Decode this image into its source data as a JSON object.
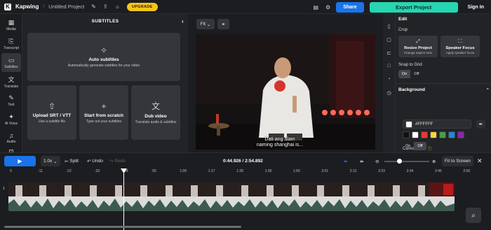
{
  "topbar": {
    "brand": "Kapwing",
    "project_title": "Untitled Project",
    "upgrade_label": "UPGRADE",
    "share_label": "Share",
    "export_label": "Export Project",
    "signin_label": "Sign In"
  },
  "nav": {
    "items": [
      {
        "label": "Media",
        "icon": "media-icon"
      },
      {
        "label": "Transcript",
        "icon": "transcript-icon"
      },
      {
        "label": "Subtitles",
        "icon": "subtitles-icon"
      },
      {
        "label": "Translate",
        "icon": "translate-icon"
      },
      {
        "label": "Text",
        "icon": "text-icon"
      },
      {
        "label": "AI Voice",
        "icon": "ai-voice-icon"
      },
      {
        "label": "Audio",
        "icon": "audio-icon"
      }
    ]
  },
  "panel": {
    "title": "SUBTITLES",
    "auto": {
      "title": "Auto subtitles",
      "subtitle": "Automatically generate subtitles for your video"
    },
    "upload": {
      "title": "Upload SRT / VTT",
      "subtitle": "Use a subtitle file"
    },
    "scratch": {
      "title": "Start from scratch",
      "subtitle": "Type out your subtitles"
    },
    "dub": {
      "title": "Dub video",
      "subtitle": "Translate audio & subtitles"
    }
  },
  "stage": {
    "fit_label": "Fit",
    "subtitle_line1": "Dati ang alam",
    "subtitle_line2": "naming shanghai is..."
  },
  "right": {
    "edit": "Edit",
    "crop": "Crop",
    "resize_title": "Resize Project",
    "resize_sub": "Change aspect ratio",
    "speaker_title": "Speaker Focus",
    "speaker_sub": "Apply speaker focus",
    "snap_label": "Snap to Grid",
    "snap_on": "On",
    "snap_off": "Off",
    "background": "Background",
    "hex": "#FFFFFF",
    "swatches": [
      "#111111",
      "#ffffff",
      "#e53935",
      "#fdd835",
      "#43a047",
      "#1e88e5",
      "#8e24aa"
    ],
    "canvas_blur": "Canvas Blur",
    "blur_on": "On",
    "blur_off": "Off"
  },
  "timeline": {
    "speed": "1.0x",
    "split": "Split",
    "undo": "Undo",
    "redo": "Redo",
    "time": "0:44.926 / 2:54.892",
    "fit_screen": "Fit to Screen",
    "ticks": [
      "0",
      ":11",
      ":22",
      ":33",
      ":44",
      ":55",
      "1:06",
      "1:17",
      "1:28",
      "1:39",
      "1:50",
      "2:01",
      "2:12",
      "2:23",
      "2:34",
      "2:45",
      "2:56"
    ],
    "track_number": "1"
  }
}
